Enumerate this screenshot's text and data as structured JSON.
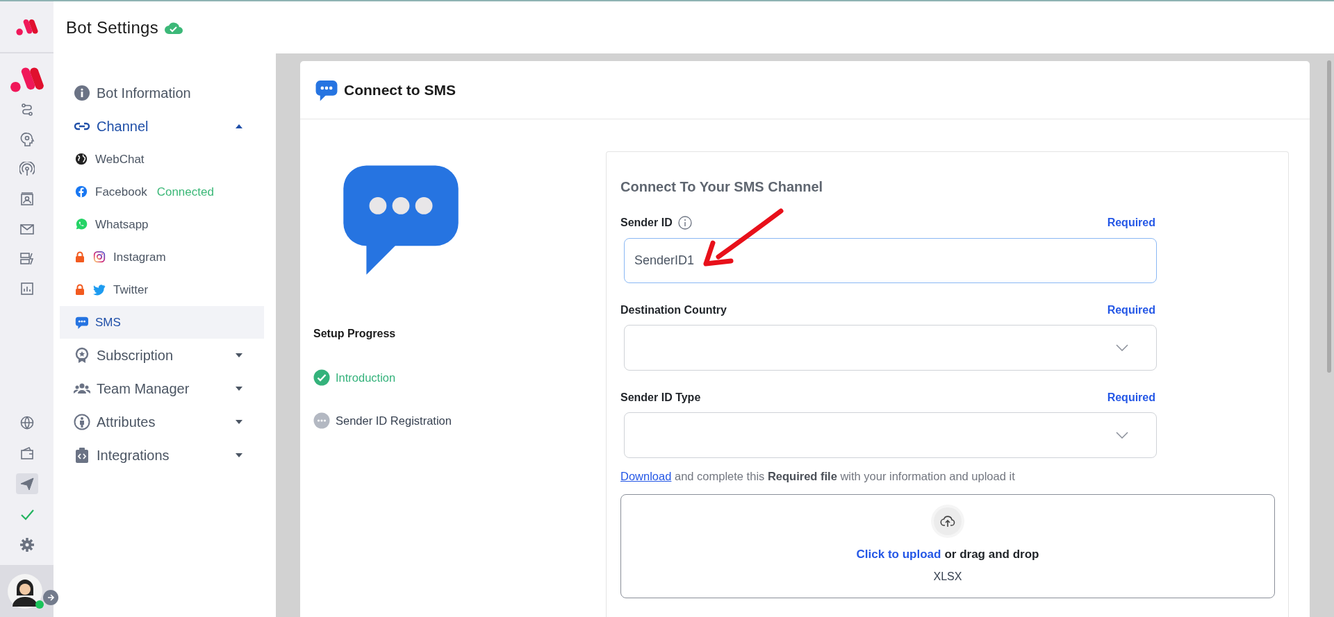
{
  "header": {
    "title": "Bot Settings"
  },
  "rail": [
    {
      "selected": false
    },
    {
      "selected": false
    },
    {
      "selected": false
    },
    {
      "selected": false
    },
    {
      "selected": false
    },
    {
      "selected": false
    },
    {
      "selected": false
    },
    {
      "selected": false
    },
    {
      "selected": false
    },
    {
      "selected": true
    },
    {
      "selected": false
    },
    {
      "selected": false
    }
  ],
  "sidebar": {
    "items": [
      {
        "label": "Bot Information",
        "kind": "plain"
      },
      {
        "label": "Channel",
        "kind": "group",
        "expanded": true,
        "children": [
          {
            "label": "WebChat",
            "locked": false,
            "selected": false
          },
          {
            "label": "Facebook",
            "status": "Connected",
            "locked": false,
            "selected": false
          },
          {
            "label": "Whatsapp",
            "locked": false,
            "selected": false
          },
          {
            "label": "Instagram",
            "locked": true,
            "selected": false
          },
          {
            "label": "Twitter",
            "locked": true,
            "selected": false
          },
          {
            "label": "SMS",
            "locked": false,
            "selected": true
          }
        ]
      },
      {
        "label": "Subscription",
        "kind": "group",
        "expanded": false
      },
      {
        "label": "Team Manager",
        "kind": "group",
        "expanded": false
      },
      {
        "label": "Attributes",
        "kind": "group",
        "expanded": false
      },
      {
        "label": "Integrations",
        "kind": "group",
        "expanded": false
      }
    ]
  },
  "card": {
    "title": "Connect to SMS",
    "progress": {
      "title": "Setup Progress",
      "steps": [
        {
          "label": "Introduction",
          "done": true
        },
        {
          "label": "Sender ID Registration",
          "done": false
        }
      ]
    },
    "form": {
      "heading": "Connect To Your SMS Channel",
      "fields": [
        {
          "kind": "text",
          "label": "Sender ID",
          "info": true,
          "required": "Required",
          "value": "SenderID1"
        },
        {
          "kind": "select",
          "label": "Destination Country",
          "info": false,
          "required": "Required"
        },
        {
          "kind": "select",
          "label": "Sender ID Type",
          "info": false,
          "required": "Required"
        }
      ],
      "note": {
        "link": "Download",
        "text": " and complete this **Required file** with your information and upload it"
      },
      "upload": {
        "link": "Click to upload",
        "text": "or drag and drop",
        "formats": "XLSX"
      }
    }
  }
}
